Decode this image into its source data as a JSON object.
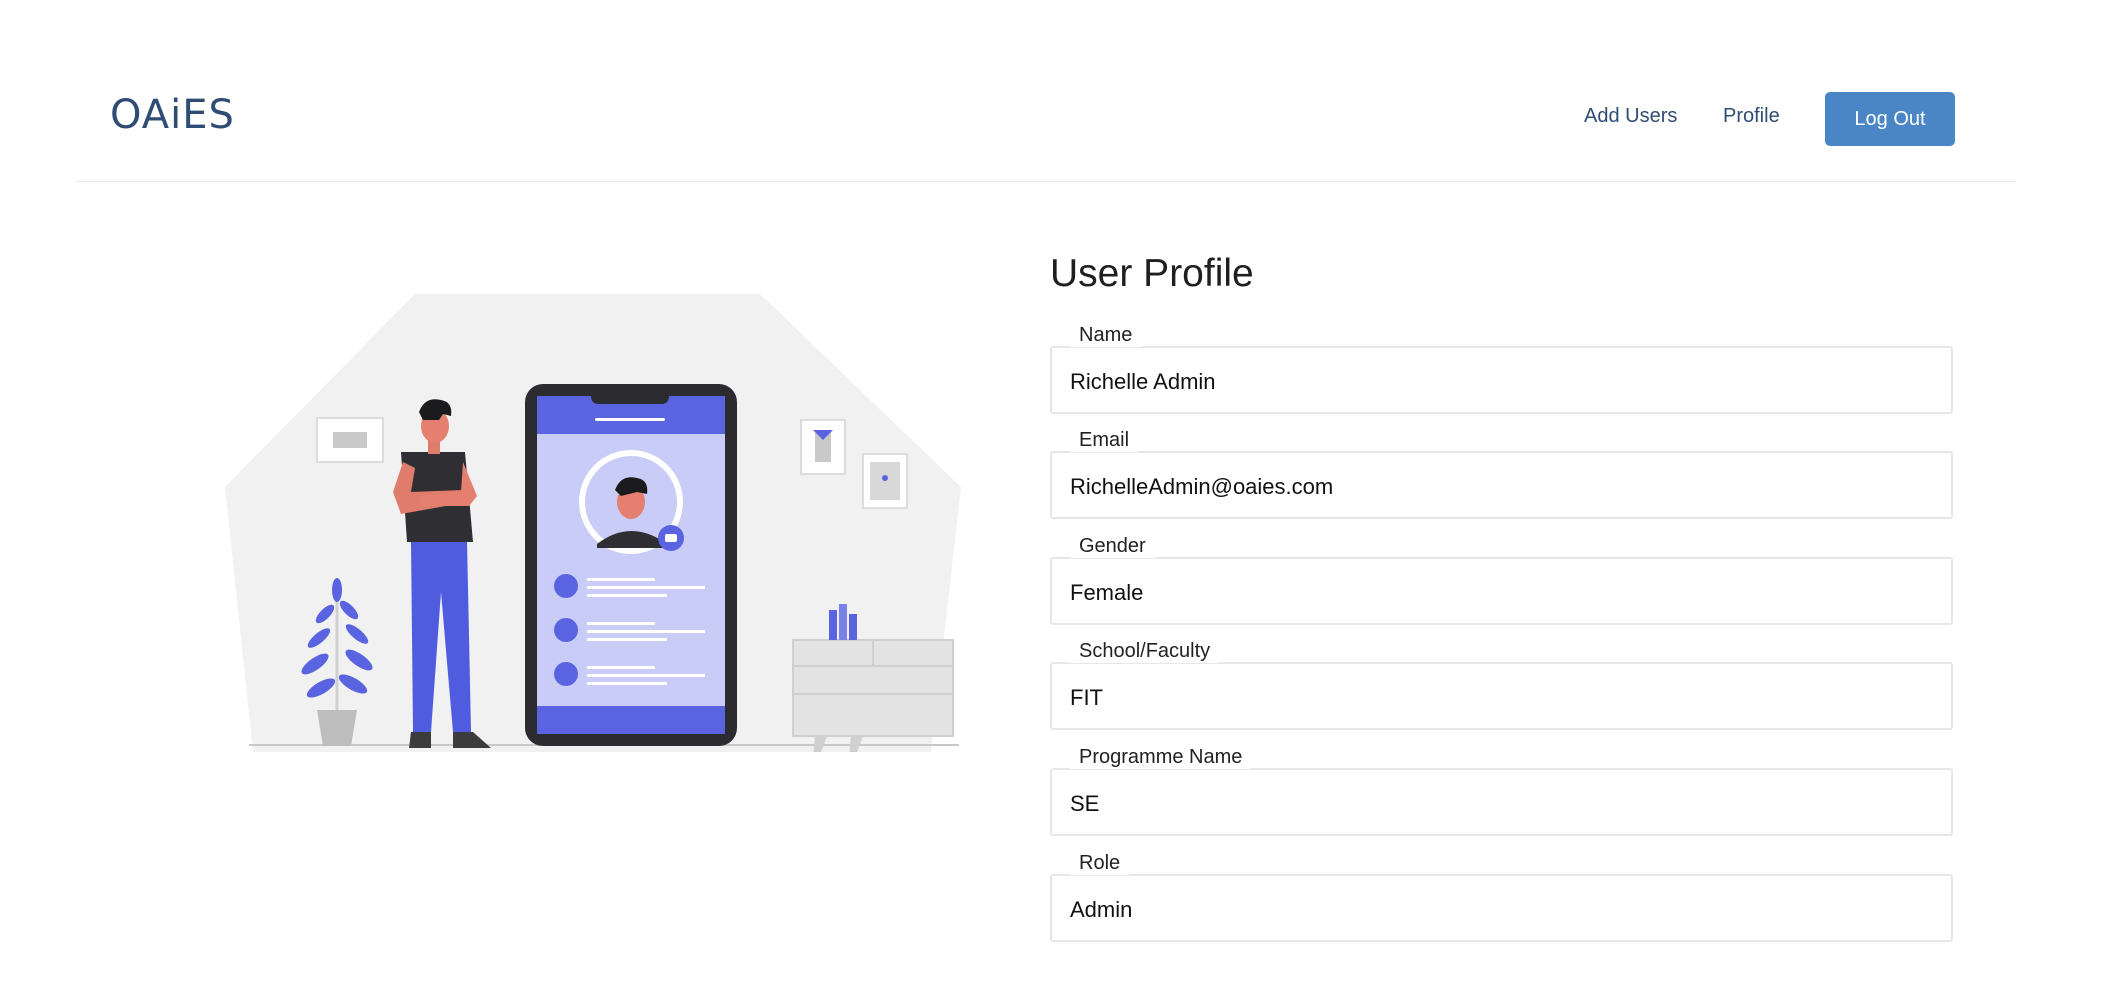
{
  "app": {
    "brand": "OAiES"
  },
  "nav": {
    "add_users": "Add Users",
    "profile": "Profile",
    "logout": "Log Out"
  },
  "page": {
    "title": "User Profile"
  },
  "fields": [
    {
      "label": "Name",
      "value": "Richelle Admin"
    },
    {
      "label": "Email",
      "value": "RichelleAdmin@oaies.com"
    },
    {
      "label": "Gender",
      "value": "Female"
    },
    {
      "label": "School/Faculty",
      "value": "FIT"
    },
    {
      "label": "Programme Name",
      "value": "SE"
    },
    {
      "label": "Role",
      "value": "Admin"
    }
  ],
  "colors": {
    "brand": "#2e4c74",
    "accent": "#4a86c6",
    "illustration_accent": "#5a63e0",
    "phone_screen": "#c9ccf7",
    "field_border": "#e6e7e9"
  },
  "illustration": {
    "name": "user-profile-illustration"
  }
}
